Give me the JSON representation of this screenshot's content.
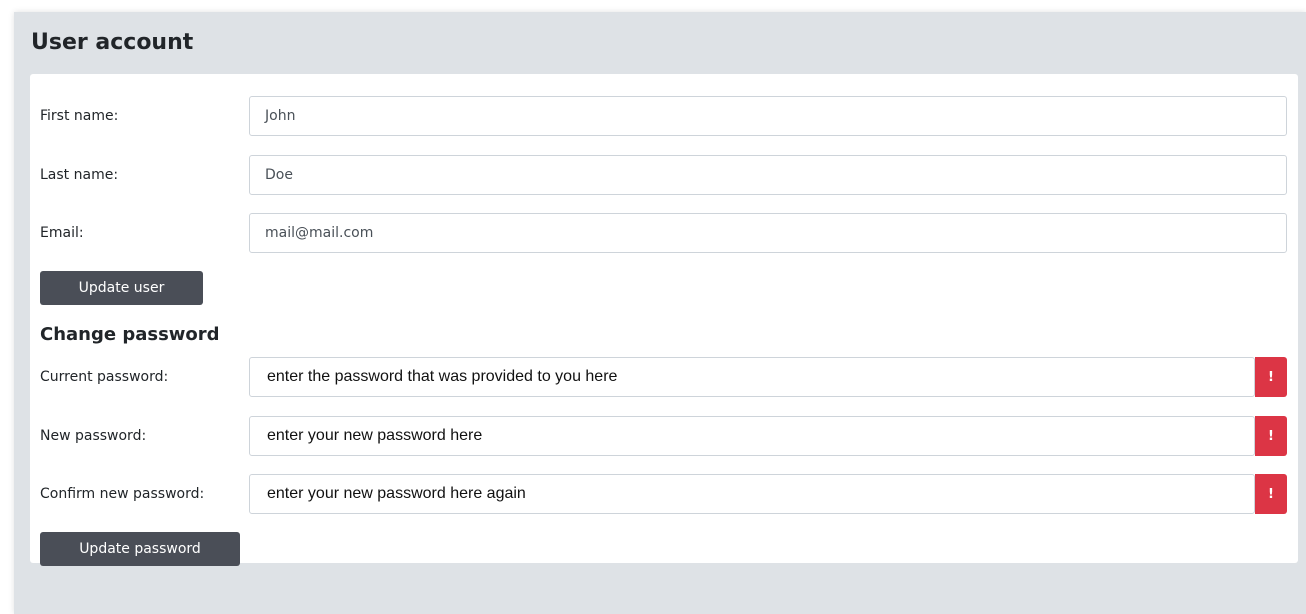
{
  "page": {
    "title": "User account"
  },
  "user_form": {
    "first_name_label": "First name:",
    "first_name_value": "John",
    "last_name_label": "Last name:",
    "last_name_value": "Doe",
    "email_label": "Email:",
    "email_value": "mail@mail.com",
    "update_button": "Update user"
  },
  "password_form": {
    "heading": "Change password",
    "current_label": "Current password:",
    "current_placeholder": "enter the password that was provided to you here",
    "new_label": "New password:",
    "new_placeholder": "enter your new password here",
    "confirm_label": "Confirm new password:",
    "confirm_placeholder": "enter your new password here again",
    "warning_glyph": "!",
    "update_button": "Update password"
  },
  "colors": {
    "page_background": "#dee2e6",
    "card_background": "#ffffff",
    "button_background": "#4a4e57",
    "error_accent": "#dc3545"
  },
  "icons": {
    "field_warning": "exclamation-icon"
  }
}
